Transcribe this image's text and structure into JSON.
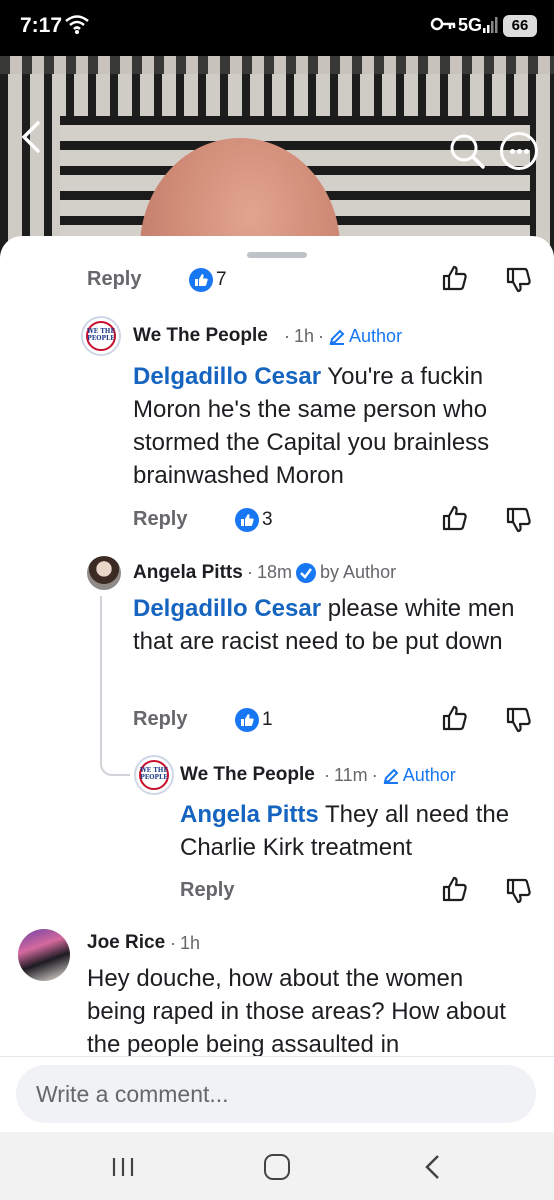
{
  "status_bar": {
    "time": "7:17",
    "network": "5G",
    "battery": "66"
  },
  "comments": [
    {
      "reply_label": "Reply",
      "likes": "7"
    },
    {
      "author": "We The People",
      "meta_time": "1h",
      "badge": "Author",
      "mention": "Delgadillo Cesar",
      "text": " You're a fuckin Moron he's the same person who stormed the Capital you brainless brainwashed Moron",
      "reply_label": "Reply",
      "likes": "3",
      "avatar_text": "WE THE PEOPLE"
    },
    {
      "author": "Angela Pitts",
      "meta_time": "18m",
      "badge": "by Author",
      "mention": "Delgadillo Cesar",
      "text": " please white men that are racist need to be put down",
      "reply_label": "Reply",
      "likes": "1"
    },
    {
      "author": "We The People",
      "meta_time": "11m",
      "badge": "Author",
      "mention": "Angela Pitts",
      "text": " They all need the Charlie Kirk treatment",
      "reply_label": "Reply",
      "avatar_text": "WE THE PEOPLE"
    },
    {
      "author": "Joe Rice",
      "meta_time": "1h",
      "text": "Hey douche, how about the women being raped in those areas? How about the people being assaulted in"
    }
  ],
  "separator": "·",
  "composer": {
    "placeholder": "Write a comment..."
  },
  "icons": {
    "like": "thumbs-up-icon",
    "dislike": "thumbs-down-icon",
    "back": "chevron-left-icon",
    "search": "search-icon",
    "more": "more-icon"
  },
  "colors": {
    "link_blue": "#1565c0",
    "like_blue": "#1877f2",
    "text": "#1c1e21",
    "meta": "#65676b"
  }
}
